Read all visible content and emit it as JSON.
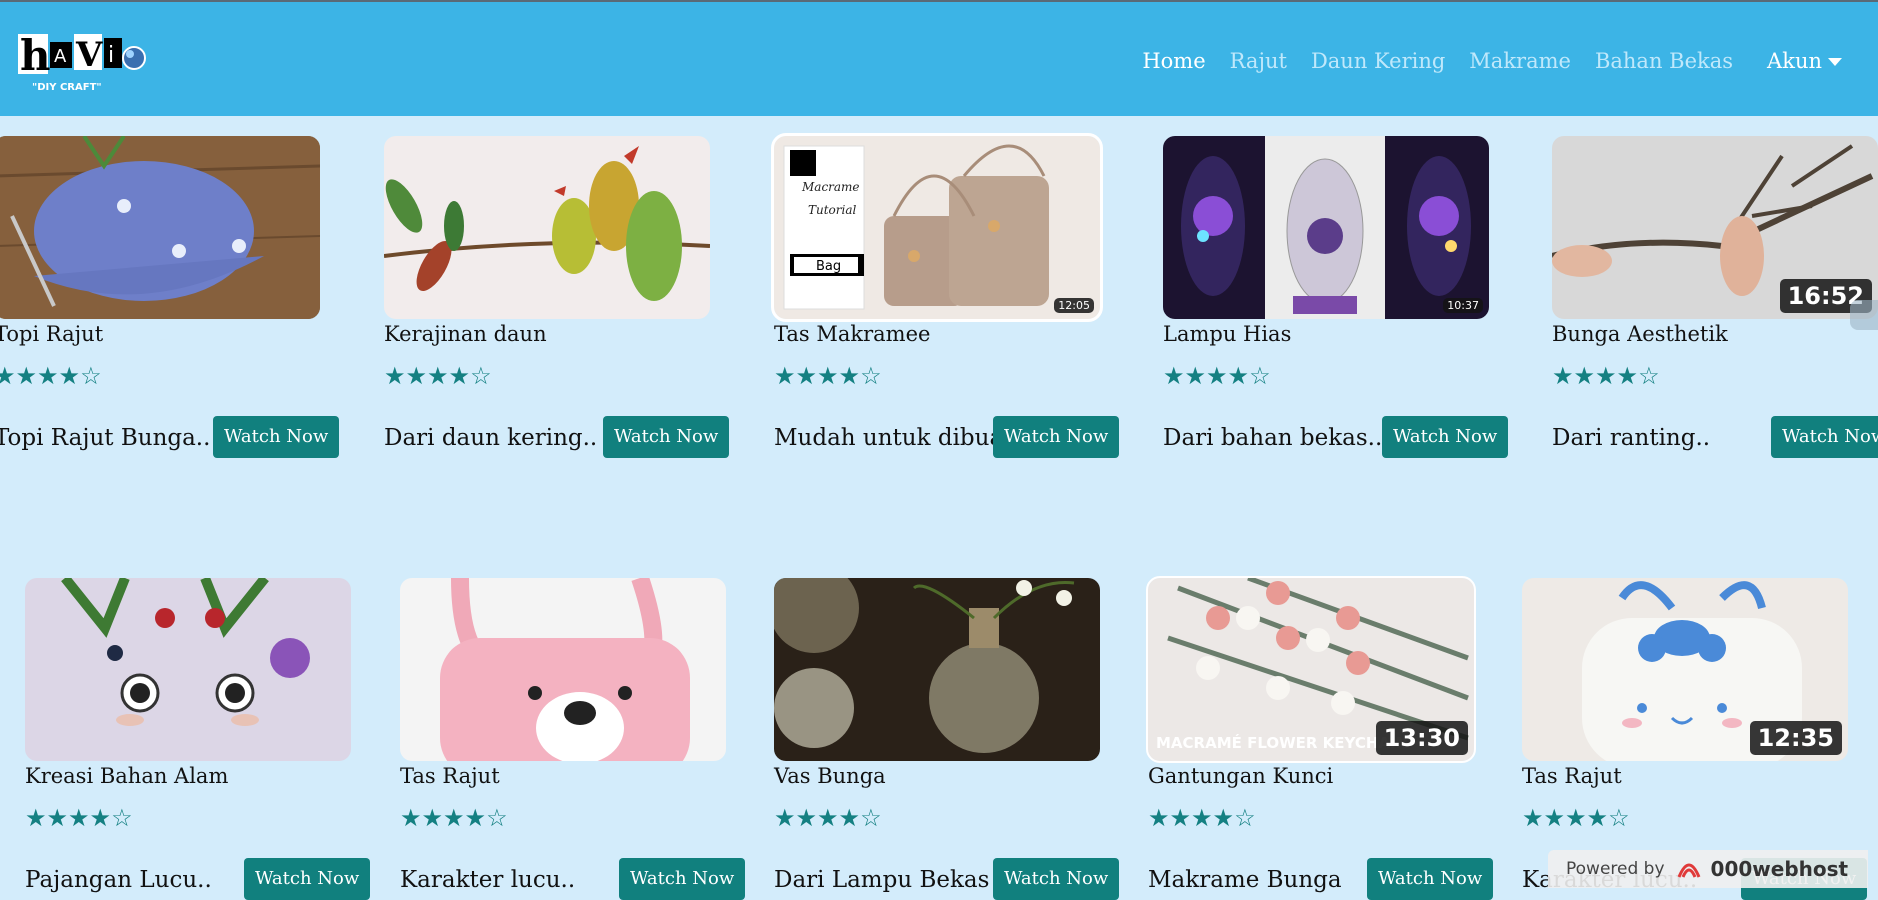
{
  "app": {
    "logo_text": "hAVi",
    "logo_tagline": "\"DIY CRAFT\""
  },
  "nav": {
    "items": [
      "Home",
      "Rajut",
      "Daun Kering",
      "Makrame",
      "Bahan Bekas"
    ],
    "active_index": 0,
    "account_label": "Akun"
  },
  "cards": [
    {
      "title": "Topi Rajut",
      "stars": "★★★★☆",
      "desc": "Topi Rajut Bunga..",
      "button": "Watch Now",
      "duration": ""
    },
    {
      "title": "Kerajinan daun",
      "stars": "★★★★☆",
      "desc": "Dari daun kering..",
      "button": "Watch Now",
      "duration": ""
    },
    {
      "title": "Tas Makramee",
      "stars": "★★★★☆",
      "desc": "Mudah untuk dibuat..",
      "button": "Watch Now",
      "duration": "12:05",
      "thumb_text_1": "Macrame",
      "thumb_text_2": "Tutorial",
      "thumb_text_3": "Bag"
    },
    {
      "title": "Lampu Hias",
      "stars": "★★★★☆",
      "desc": "Dari bahan bekas..",
      "button": "Watch Now",
      "duration": "10:37"
    },
    {
      "title": "Bunga Aesthetik",
      "stars": "★★★★☆",
      "desc": "Dari ranting..",
      "button": "Watch Now",
      "duration": "16:52"
    },
    {
      "title": "Kreasi Bahan Alam",
      "stars": "★★★★☆",
      "desc": "Pajangan Lucu..",
      "button": "Watch Now",
      "duration": ""
    },
    {
      "title": "Tas Rajut",
      "stars": "★★★★☆",
      "desc": "Karakter lucu..",
      "button": "Watch Now",
      "duration": ""
    },
    {
      "title": "Vas Bunga",
      "stars": "★★★★☆",
      "desc": "Dari Lampu Bekas",
      "button": "Watch Now",
      "duration": ""
    },
    {
      "title": "Gantungan Kunci",
      "stars": "★★★★☆",
      "desc": "Makrame Bunga",
      "button": "Watch Now",
      "duration": "13:30",
      "thumb_text_1": "MACRAMÉ FLOWER KEYCHAIN"
    },
    {
      "title": "Tas Rajut",
      "stars": "★★★★☆",
      "desc": "Karakter lucu..",
      "button": "Watch Now",
      "duration": "12:35"
    }
  ],
  "footer": {
    "powered_label": "Powered by",
    "powered_brand": "000webhost"
  },
  "colors": {
    "header": "#3cb4e6",
    "page_bg": "#d3ecfb",
    "button": "#11807e",
    "stars": "#148082"
  }
}
